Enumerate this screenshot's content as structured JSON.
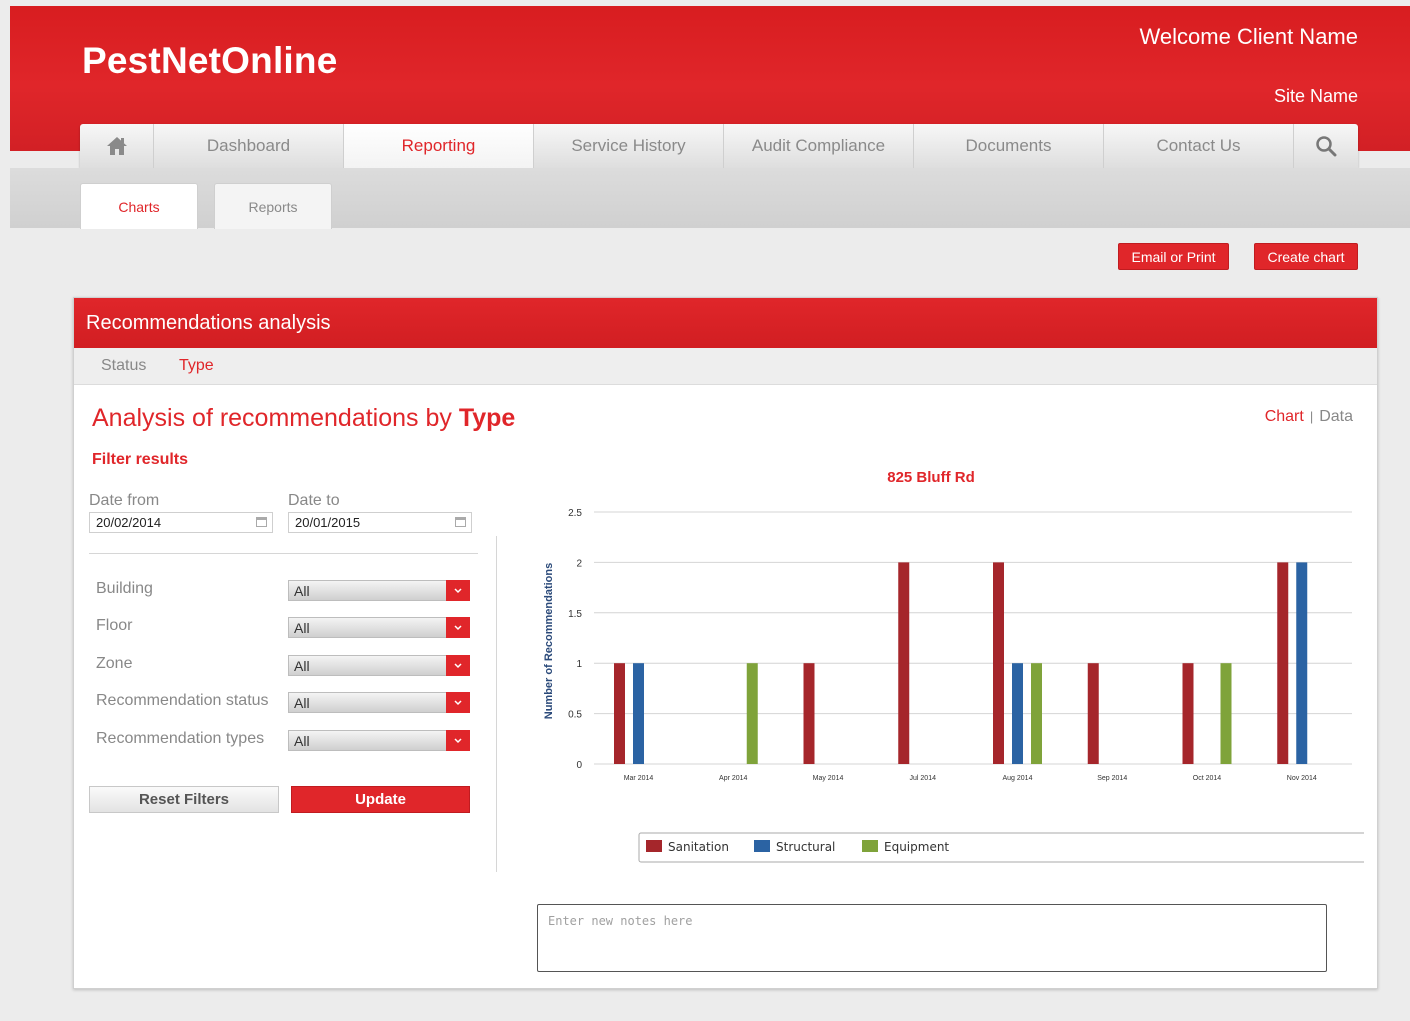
{
  "header": {
    "logo": "PestNetOnline",
    "welcome": "Welcome Client Name",
    "site_name": "Site Name"
  },
  "nav": {
    "home_icon": "home-icon",
    "items": [
      "Dashboard",
      "Reporting",
      "Service History",
      "Audit Compliance",
      "Documents",
      "Contact Us"
    ],
    "active": "Reporting",
    "search_icon": "search-icon"
  },
  "subtabs": {
    "items": [
      "Charts",
      "Reports"
    ],
    "active": "Charts"
  },
  "actions": {
    "email_print": "Email or Print",
    "create_chart": "Create chart"
  },
  "panel": {
    "title": "Recommendations analysis",
    "tabs": [
      "Status",
      "Type"
    ],
    "active_tab": "Type",
    "analysis_title_prefix": "Analysis of recommendations by",
    "analysis_title_bold": "Type",
    "view_chart": "Chart",
    "view_sep": "|",
    "view_data": "Data"
  },
  "filters": {
    "heading": "Filter results",
    "date_from_label": "Date from",
    "date_from_value": "20/02/2014",
    "date_to_label": "Date to",
    "date_to_value": "20/01/2015",
    "selects": [
      {
        "label": "Building",
        "value": "All"
      },
      {
        "label": "Floor",
        "value": "All"
      },
      {
        "label": "Zone",
        "value": "All"
      },
      {
        "label": "Recommendation status",
        "value": "All"
      },
      {
        "label": "Recommendation types",
        "value": "All"
      }
    ],
    "reset_label": "Reset Filters",
    "update_label": "Update"
  },
  "notes": {
    "placeholder": "Enter new notes here"
  },
  "colors": {
    "accent": "#e0262a",
    "sanitation": "#a5262b",
    "structural": "#2b63a3",
    "equipment": "#7fa33a"
  },
  "chart_data": {
    "type": "bar",
    "title": "825 Bluff Rd",
    "xlabel": "",
    "ylabel": "Number of Recommendations",
    "ylim": [
      0,
      2.5
    ],
    "yticks": [
      "0",
      "0.5",
      "1",
      "1.5",
      "2",
      "2.5"
    ],
    "categories": [
      "Mar 2014",
      "Apr 2014",
      "May 2014",
      "Jul 2014",
      "Aug 2014",
      "Sep 2014",
      "Oct 2014",
      "Nov 2014"
    ],
    "series": [
      {
        "name": "Sanitation",
        "values": [
          1,
          0,
          1,
          2,
          2,
          1,
          1,
          2
        ]
      },
      {
        "name": "Structural",
        "values": [
          1,
          0,
          0,
          0,
          1,
          0,
          0,
          2
        ]
      },
      {
        "name": "Equipment",
        "values": [
          0,
          1,
          0,
          0,
          1,
          0,
          1,
          0
        ]
      }
    ],
    "grid": true,
    "legend": "bottom"
  }
}
